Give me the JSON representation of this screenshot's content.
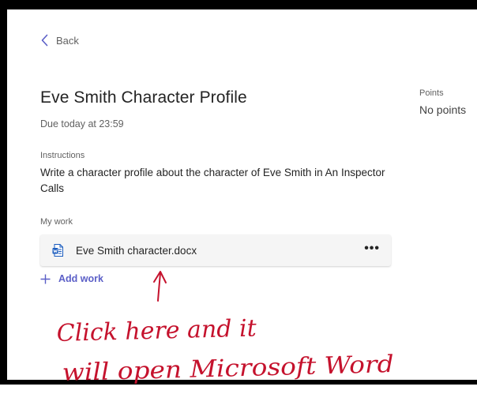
{
  "nav": {
    "back_label": "Back"
  },
  "assignment": {
    "title": "Eve Smith Character Profile",
    "due": "Due today at 23:59"
  },
  "points": {
    "label": "Points",
    "value": "No points"
  },
  "instructions": {
    "label": "Instructions",
    "text": "Write a character profile about the character of Eve Smith in An Inspector Calls"
  },
  "my_work": {
    "label": "My work",
    "file_name": "Eve Smith character.docx",
    "more_label": "•••",
    "add_label": "Add work"
  },
  "annotation": {
    "line1": "Click here and it",
    "line2": "will open Microsoft Word",
    "color": "#c5122d"
  },
  "colors": {
    "accent": "#5b5fc7",
    "word_blue": "#185abd",
    "frame": "#000000"
  }
}
